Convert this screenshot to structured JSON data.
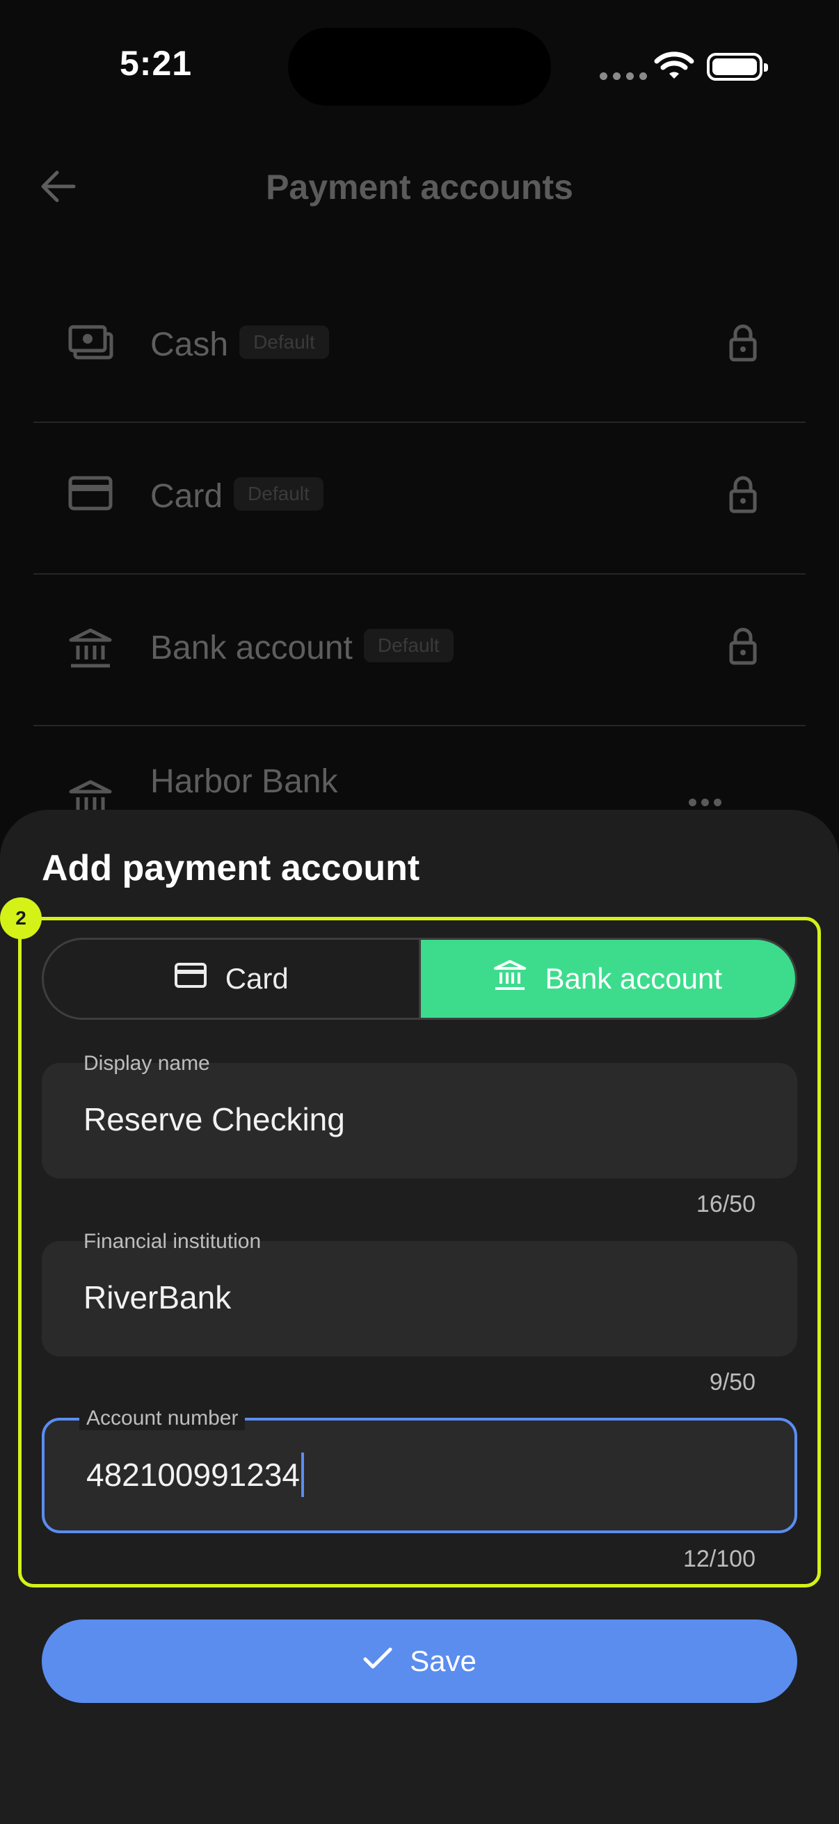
{
  "status_bar": {
    "time": "5:21"
  },
  "header": {
    "title": "Payment accounts"
  },
  "accounts": [
    {
      "label": "Cash",
      "badge": "Default",
      "icon": "cash-icon"
    },
    {
      "label": "Card",
      "badge": "Default",
      "icon": "card-icon"
    },
    {
      "label": "Bank account",
      "badge": "Default",
      "icon": "bank-icon"
    },
    {
      "label": "Harbor Bank",
      "icon": "bank-icon"
    }
  ],
  "sheet": {
    "title": "Add payment account",
    "highlight_index": "2",
    "tabs": [
      {
        "label": "Card",
        "icon": "card-icon",
        "selected": false
      },
      {
        "label": "Bank account",
        "icon": "bank-icon",
        "selected": true
      }
    ],
    "fields": {
      "display_name": {
        "label": "Display name",
        "value": "Reserve Checking",
        "counter": "16/50"
      },
      "institution": {
        "label": "Financial institution",
        "value": "RiverBank",
        "counter": "9/50"
      },
      "account_number": {
        "label": "Account number",
        "value": "482100991234",
        "counter": "12/100"
      }
    },
    "save_label": "Save"
  },
  "colors": {
    "accent_blue": "#5b8def",
    "accent_green": "#3ddc8d",
    "highlight": "#d4f218",
    "sheet_bg": "#1e1e1f"
  }
}
